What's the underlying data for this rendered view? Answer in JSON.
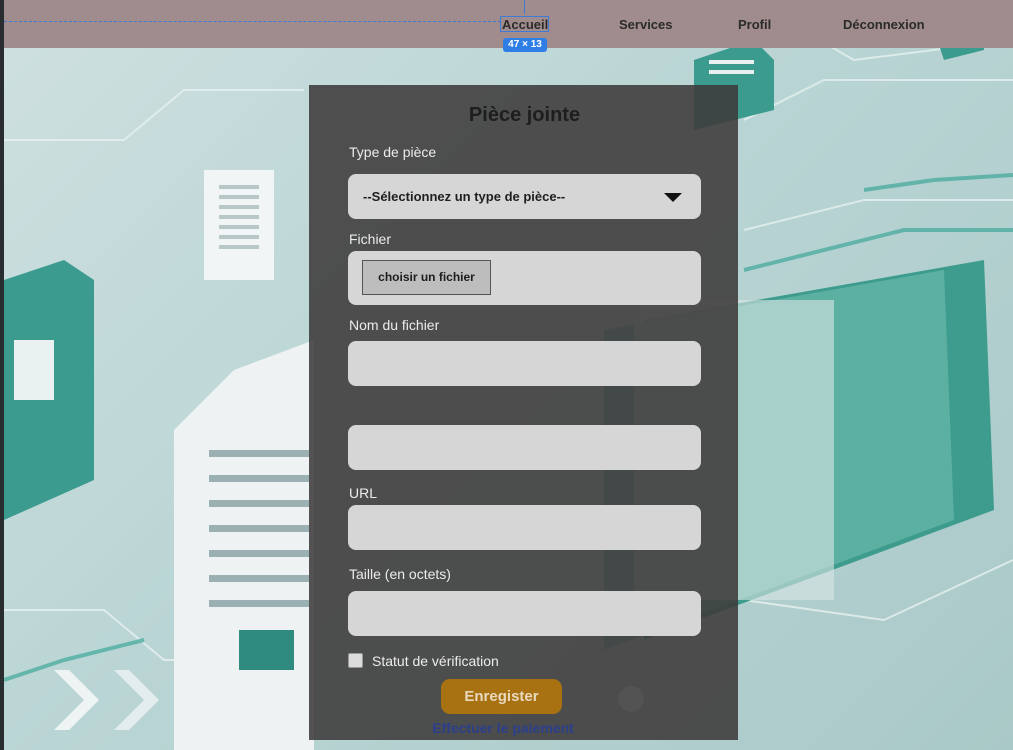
{
  "nav": {
    "items": [
      {
        "label": "Accueil"
      },
      {
        "label": "Services"
      },
      {
        "label": "Profil"
      },
      {
        "label": "Déconnexion"
      }
    ],
    "size_badge": "47 × 13"
  },
  "form": {
    "title": "Pièce jointe",
    "type_label": "Type de pièce",
    "type_select_value": "--Sélectionnez un type de pièce--",
    "file_label": "Fichier",
    "file_button": "choisir un fichier",
    "filename_label": "Nom du fichier",
    "filename_value": "",
    "unlabeled_value": "",
    "url_label": "URL",
    "url_value": "",
    "size_label": "Taille (en octets)",
    "size_value": "",
    "verification_label": "Statut de vérification",
    "submit_label": "Enregister",
    "payment_link": "Effectuer le paiement"
  },
  "colors": {
    "navbar": "#a08c8c",
    "panel": "#3e3a3a",
    "submit": "#a87212",
    "link": "#2b3f8c",
    "guide": "#3d7bd4"
  }
}
